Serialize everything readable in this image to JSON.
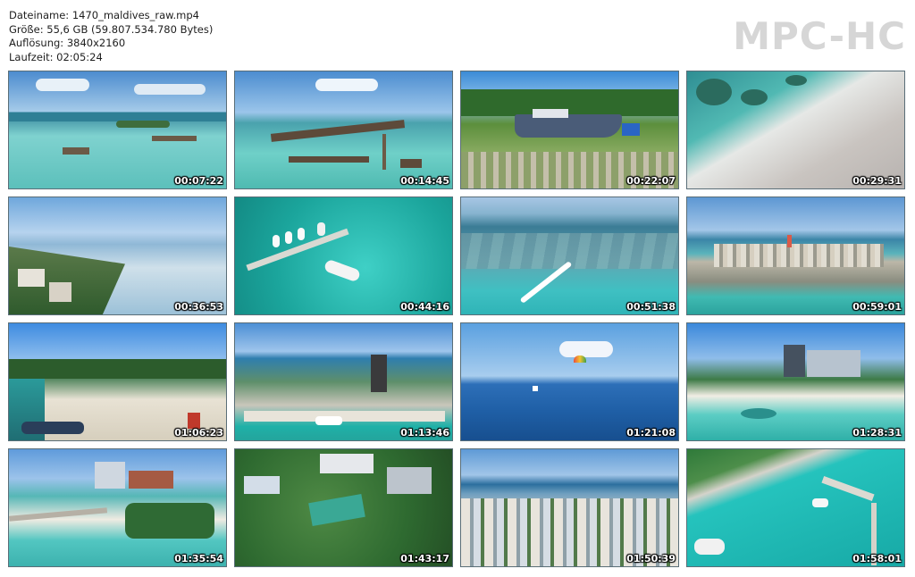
{
  "info": {
    "filename": "Dateiname: 1470_maldives_raw.mp4",
    "size": "Größe: 55,6 GB (59.807.534.780 Bytes)",
    "resolution": "Auflösung: 3840x2160",
    "duration": "Laufzeit: 02:05:24"
  },
  "logo": "MPC-HC",
  "thumbnails": [
    {
      "time": "00:07:22",
      "scene": "water-villas-lagoon"
    },
    {
      "time": "00:14:45",
      "scene": "overwater-bungalows-pier"
    },
    {
      "time": "00:22:07",
      "scene": "boat-on-shore-palms"
    },
    {
      "time": "00:29:31",
      "scene": "aerial-beach-coral"
    },
    {
      "time": "00:36:53",
      "scene": "island-town-coastline"
    },
    {
      "time": "00:44:16",
      "scene": "boats-at-jetty"
    },
    {
      "time": "00:51:38",
      "scene": "speedboat-wake-reef"
    },
    {
      "time": "00:59:01",
      "scene": "island-city-horizon"
    },
    {
      "time": "01:06:23",
      "scene": "beach-with-boats"
    },
    {
      "time": "01:13:46",
      "scene": "harbor-city-tower"
    },
    {
      "time": "01:21:08",
      "scene": "parasail-open-sea"
    },
    {
      "time": "01:28:31",
      "scene": "hotel-beach-lagoon"
    },
    {
      "time": "01:35:54",
      "scene": "beach-breakwater-buildings"
    },
    {
      "time": "01:43:17",
      "scene": "town-rooftops-trees"
    },
    {
      "time": "01:50:39",
      "scene": "dense-city-aerial"
    },
    {
      "time": "01:58:01",
      "scene": "marina-boats-turquoise"
    }
  ]
}
